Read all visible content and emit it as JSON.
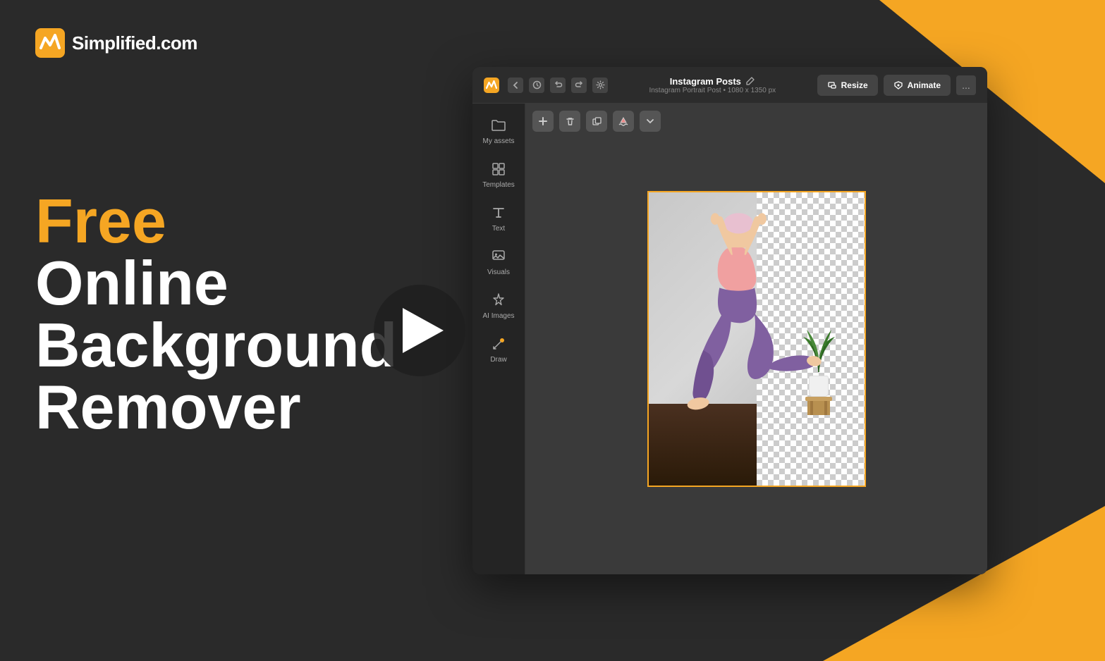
{
  "brand": {
    "name": "Simplified.com",
    "logo_alt": "Simplified logo"
  },
  "hero": {
    "line1": "Free",
    "line2": "Online",
    "line3": "Background",
    "line4": "Remover"
  },
  "app": {
    "header": {
      "project_title": "Instagram Posts",
      "project_subtitle": "Instagram Portrait Post • 1080 x 1350 px",
      "resize_label": "Resize",
      "animate_label": "Animate",
      "more_label": "..."
    },
    "sidebar": {
      "items": [
        {
          "id": "my-assets",
          "label": "My assets",
          "icon": "folder"
        },
        {
          "id": "templates",
          "label": "Templates",
          "icon": "grid"
        },
        {
          "id": "text",
          "label": "Text",
          "icon": "A"
        },
        {
          "id": "visuals",
          "label": "Visuals",
          "icon": "visuals"
        },
        {
          "id": "ai-images",
          "label": "AI Images",
          "icon": "magic"
        },
        {
          "id": "draw",
          "label": "Draw",
          "icon": "draw"
        }
      ]
    },
    "canvas": {
      "dimensions": "1080 x 1350 px"
    }
  },
  "colors": {
    "accent": "#f5a623",
    "background": "#2a2a2a",
    "app_dark": "#1a1a1a",
    "app_header": "#2c2c2c",
    "sidebar": "#242424"
  }
}
